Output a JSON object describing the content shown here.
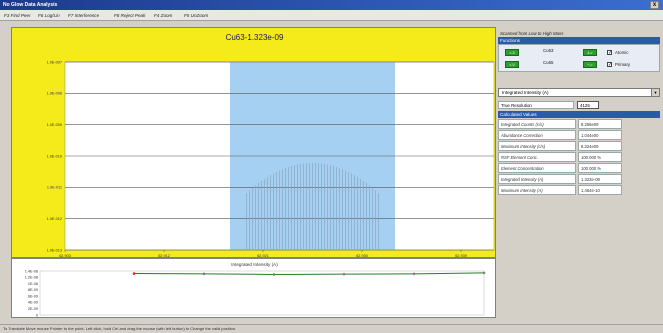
{
  "window": {
    "title": "No Glow Data Analysis",
    "close": "x"
  },
  "toolbar": {
    "buttons": [
      {
        "label": "F3 Find Peer"
      },
      {
        "label": "F6 Log/Lin"
      },
      {
        "label": "F7 Interference"
      },
      {
        "label": "F8 Reject Peak"
      },
      {
        "label": "F4 Zoom"
      },
      {
        "label": "F5 UnZoom"
      }
    ]
  },
  "chart_data": [
    {
      "type": "bar",
      "title": "Cu63-1.323e-09",
      "yscale": "log",
      "ytick_labels": [
        "1.0E-007",
        "1.0E-008",
        "1.0E-009",
        "1.0E-010",
        "1.0E-011",
        "1.0E-012",
        "1.0E-013"
      ],
      "xtick_labels": [
        "62.903",
        "62.912",
        "62.921",
        "62.930",
        "62.939"
      ],
      "xlim": [
        62.903,
        62.942
      ],
      "highlight_x_range": [
        62.918,
        62.933
      ],
      "bars": {
        "x_start": 62.9195,
        "x_end": 62.9315,
        "count": 45,
        "peak_x": 62.9255,
        "peak_value": 6e-11,
        "edge_value": 5e-13
      },
      "colors": {
        "background": "#f5ea1a",
        "plot": "#ffffff",
        "highlight": "#a6d0f2",
        "bars": "#8aa6c0"
      }
    },
    {
      "type": "line",
      "title": "Integrated Intensity (A)",
      "ytick_labels": [
        "1.4E-08",
        "1.2E-08",
        "1E-08",
        "8E-09",
        "6E-09",
        "4E-09",
        "2E-09",
        "0"
      ],
      "ylim": [
        0,
        1.4e-08
      ],
      "x": [
        1,
        2,
        3,
        4,
        5,
        6
      ],
      "values": [
        1.32e-08,
        1.31e-08,
        1.29e-08,
        1.3e-08,
        1.31e-08,
        1.34e-08
      ],
      "colors": {
        "line": "#2d7a2d",
        "first_marker": "#e0201a",
        "markers": "#808080"
      }
    }
  ],
  "right_panel": {
    "scan_header": "Scanned from Low to High Mass",
    "functions_header": "Functions",
    "row1": {
      "prev": "<-3",
      "label": "Cu63",
      "next": "4->",
      "check_label": "Atomic",
      "checked": true
    },
    "row2": {
      "prev": "<-V",
      "label": "Cu65",
      "next": "^->",
      "check_label": "Primary",
      "checked": true
    },
    "dropdown": {
      "value": "Integrated Intensity (A)"
    },
    "true_resolution": {
      "label": "True Resolution",
      "value": "4125"
    },
    "calc_header": "Calculated Values",
    "calc": [
      {
        "label": "Integrated Counts (c/s)",
        "value": "8.256e09"
      },
      {
        "label": "Abundance Correction",
        "value": "1.044e00"
      },
      {
        "label": "Maximum Intensity (c/s)",
        "value": "8.324e09"
      },
      {
        "label": "RSF Element Conc.",
        "value": "100.000 %"
      },
      {
        "label": "Element Concentration",
        "value": "100.000 %"
      },
      {
        "label": "Integrated Intensity (A)",
        "value": "1.323e-09"
      },
      {
        "label": "Maximum Intensity (A)",
        "value": "1.464e-10"
      }
    ]
  },
  "status": "To Translate Move mouse Pointer to the point. Left click, hold Ctrl and drag the mouse (with left button) to Change the valid position."
}
